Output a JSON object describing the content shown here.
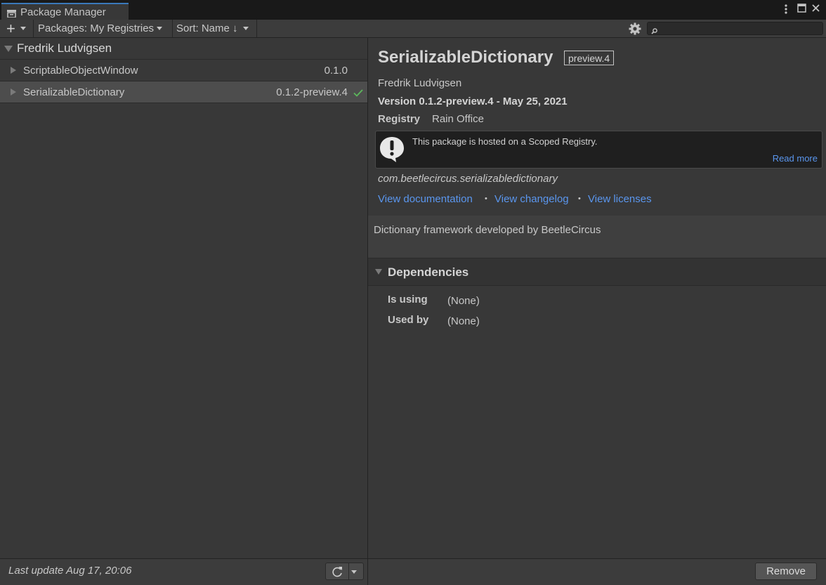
{
  "window": {
    "title": "Package Manager"
  },
  "toolbar": {
    "add_label": "+",
    "packages_dropdown": "Packages: My Registries",
    "sort_dropdown": "Sort: Name ↓",
    "search_placeholder": ""
  },
  "list": {
    "group_name": "Fredrik Ludvigsen",
    "packages": [
      {
        "name": "ScriptableObjectWindow",
        "version": "0.1.0",
        "installed": false,
        "selected": false
      },
      {
        "name": "SerializableDictionary",
        "version": "0.1.2-preview.4",
        "installed": true,
        "selected": true
      }
    ]
  },
  "details": {
    "title": "SerializableDictionary",
    "tag": "preview.4",
    "author": "Fredrik Ludvigsen",
    "version_line": "Version 0.1.2-preview.4 - May 25, 2021",
    "registry_label": "Registry",
    "registry_value": "Rain Office",
    "notice_text": "This package is hosted on a Scoped Registry.",
    "notice_link": "Read more",
    "package_id": "com.beetlecircus.serializabledictionary",
    "links": {
      "documentation": "View documentation",
      "changelog": "View changelog",
      "licenses": "View licenses",
      "separator": "•"
    },
    "description": "Dictionary framework developed by BeetleCircus",
    "dependencies": {
      "header": "Dependencies",
      "is_using_label": "Is using",
      "is_using_value": "(None)",
      "used_by_label": "Used by",
      "used_by_value": "(None)"
    }
  },
  "footer": {
    "last_update": "Last update Aug 17, 20:06",
    "remove_label": "Remove"
  },
  "colors": {
    "link": "#5a96ee",
    "check": "#5cb85c",
    "tab_accent": "#3a79bb"
  }
}
